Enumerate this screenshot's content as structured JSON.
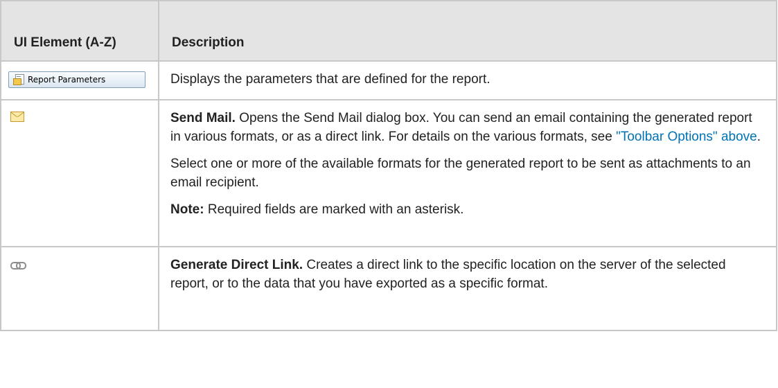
{
  "table": {
    "headers": [
      "UI Element (A-Z)",
      "Description"
    ],
    "rows": [
      {
        "element_label": "Report Parameters",
        "element_icon": "report-parameters-icon",
        "desc_p1": "Displays the parameters that are defined for the report."
      },
      {
        "element_icon": "mail-icon",
        "desc_p1_bold": "Send Mail.",
        "desc_p1_text": " Opens the Send Mail dialog box. You can send an email containing the generated report in various formats, or as a direct link. For details on the various formats, see ",
        "desc_p1_link": "\"Toolbar Options\" above",
        "desc_p1_end": ".",
        "desc_p2": "Select one or more of the available formats for the generated report to be sent as attachments to an email recipient.",
        "desc_p3_bold": "Note:",
        "desc_p3_text": " Required fields are marked with an asterisk."
      },
      {
        "element_icon": "link-icon",
        "desc_p1_bold": "Generate Direct Link.",
        "desc_p1_text": " Creates a direct link to the specific location on the server of the selected report, or to the data that you have exported as a specific format."
      }
    ]
  },
  "colors": {
    "header_background": "#e4e4e4",
    "border": "#c8c8c8",
    "link": "#0073b6"
  }
}
